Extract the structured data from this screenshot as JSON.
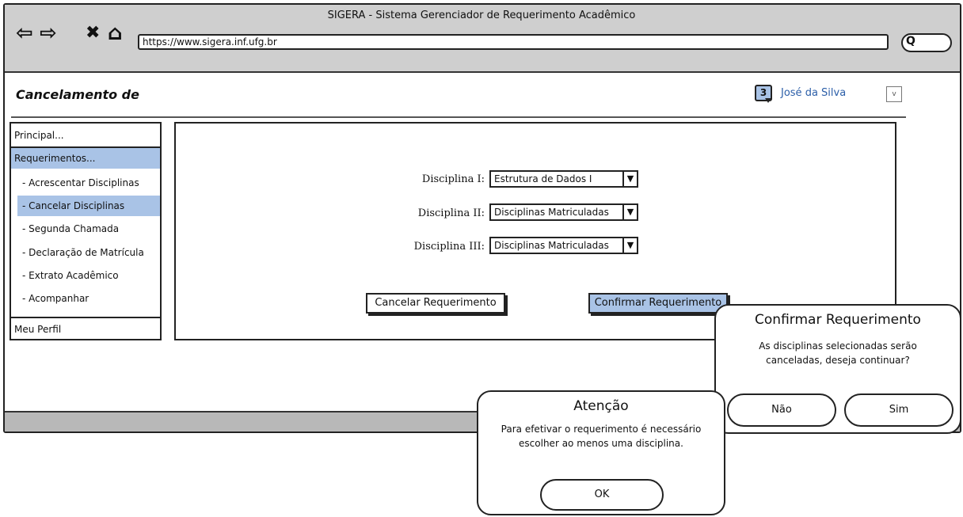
{
  "browser": {
    "title": "SIGERA - Sistema Gerenciador de Requerimento Acadêmico",
    "url": "https://www.sigera.inf.ufg.br",
    "nav": {
      "back": "⇦",
      "forward": "⇨",
      "stop": "✖",
      "home": "⌂",
      "search": "Q"
    }
  },
  "header": {
    "page_title": "Cancelamento de",
    "notification_count": "3",
    "user_name": "José da Silva",
    "user_menu": "v"
  },
  "sidebar": {
    "items": [
      {
        "label": "Principal..."
      },
      {
        "label": "Requerimentos..."
      },
      {
        "label": "- Acrescentar Disciplinas"
      },
      {
        "label": "- Cancelar Disciplinas"
      },
      {
        "label": "- Segunda Chamada"
      },
      {
        "label": "- Declaração de Matrícula"
      },
      {
        "label": "- Extrato Acadêmico"
      },
      {
        "label": "- Acompanhar"
      },
      {
        "label": "Meu Perfil"
      }
    ]
  },
  "form": {
    "fields": [
      {
        "label": "Disciplina I:",
        "value": "Estrutura de Dados I"
      },
      {
        "label": "Disciplina II:",
        "value": "Disciplinas Matriculadas"
      },
      {
        "label": "Disciplina III:",
        "value": "Disciplinas Matriculadas"
      }
    ],
    "cancel_label": "Cancelar Requerimento",
    "confirm_label": "Confirmar Requerimento"
  },
  "confirm_dialog": {
    "title": "Confirmar Requerimento",
    "text_line1": "As disciplinas selecionadas serão",
    "text_line2": "canceladas, deseja continuar?",
    "no_label": "Não",
    "yes_label": "Sim"
  },
  "alert_dialog": {
    "title": "Atenção",
    "text_line1": "Para efetivar o requerimento é necessário",
    "text_line2": "escolher ao menos uma disciplina.",
    "ok_label": "OK"
  },
  "colors": {
    "accent": "#a9c3e6",
    "link": "#2b5ea8",
    "chrome": "#cfcfcf"
  }
}
